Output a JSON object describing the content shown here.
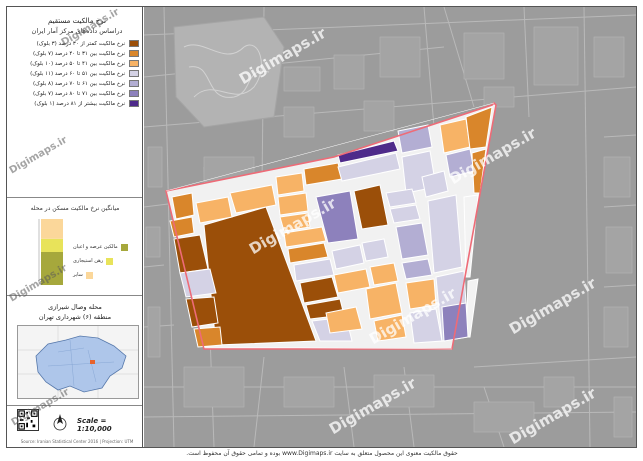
{
  "legend": {
    "title": "نرخ مالکیت مستقیم",
    "subtitle": "دراساس داده‌های مرکز آمار ایران",
    "items": [
      {
        "label": "نرخ مالکیت کمتر از ۳۰ درصد (۳ بلوک)",
        "color": "#9b4f09"
      },
      {
        "label": "نرخ مالکیت بین ۳۱ تا ۴۰ درصد (۷ بلوک)",
        "color": "#d9862b"
      },
      {
        "label": "نرخ مالکیت بین ۴۱ تا ۵۰ درصد (۱۰ بلوک)",
        "color": "#f7b366"
      },
      {
        "label": "نرخ مالکیت بین ۵۱ تا ۶۰ درصد (۱۱ بلوک)",
        "color": "#d4d2e5"
      },
      {
        "label": "نرخ مالکیت بین ۶۱ تا ۷۰ درصد (۸ بلوک)",
        "color": "#b3aed3"
      },
      {
        "label": "نرخ مالکیت بین ۷۱ تا ۸۰ درصد (۷ بلوک)",
        "color": "#8d81bc"
      },
      {
        "label": "نرخ مالکیت بیشتر از ۸۱ درصد (۱ بلوک)",
        "color": "#4e2a8a"
      }
    ]
  },
  "bar_chart": {
    "title": "میانگین نرخ مالکیت مسکن در محله",
    "segments": [
      {
        "label": "مالکین عرصه و اعیان",
        "value": 50,
        "color": "#a6a83c"
      },
      {
        "label": "رهن استیجاری",
        "value": 20,
        "color": "#e8e35a"
      },
      {
        "label": "سایر",
        "value": 30,
        "color": "#fbd79a"
      }
    ]
  },
  "neighbourhood": {
    "title": "محله وصال شیرازی",
    "subtitle": "منطقه (۶) شهرداری تهران"
  },
  "scale_text": "Scale = 1:10,000",
  "north_label": "N",
  "credit": "Source: Iranian Statistical Center 2016 | Projection: UTM",
  "footer": "حقوق مالکیت معنوی این محصول متعلق به سایت www.Digimaps.ir بوده و تمامی حقوق آن محفوظ است.",
  "watermark": "Digimaps.ir",
  "colors": {
    "map_bg": "#9c9c9c",
    "boundary": "#ee6b77",
    "block_white": "#f3f3f3"
  }
}
